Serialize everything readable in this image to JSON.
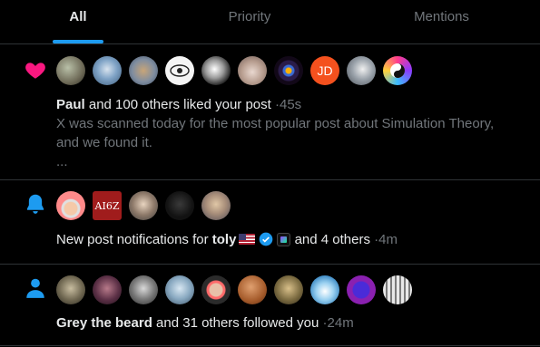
{
  "tabs": [
    {
      "label": "All",
      "active": true
    },
    {
      "label": "Priority",
      "active": false
    },
    {
      "label": "Mentions",
      "active": false
    }
  ],
  "colors": {
    "accent": "#1d9bf0",
    "like": "#f91880",
    "notify": "#1d9bf0",
    "follow": "#1d9bf0"
  },
  "notifications": [
    {
      "kind": "like",
      "icon": "heart-icon",
      "actor": "Paul",
      "text": "and 100 others liked your post",
      "separator": "·",
      "time": "45s",
      "preview_lines": [
        "X was scanned today for the most popular post about Simulation Theory,",
        "and we found it."
      ],
      "ellipsis": "...",
      "avatar_initials": "JD"
    },
    {
      "kind": "notify",
      "icon": "bell-icon",
      "prefix": "New post notifications for",
      "actor": "toly",
      "suffix": "and 4 others",
      "separator": "·",
      "time": "4m",
      "avatar_text": "AI6Z"
    },
    {
      "kind": "follow",
      "icon": "person-icon",
      "actor": "Grey the beard",
      "text": "and 31 others followed you",
      "separator": "·",
      "time": "24m"
    }
  ]
}
